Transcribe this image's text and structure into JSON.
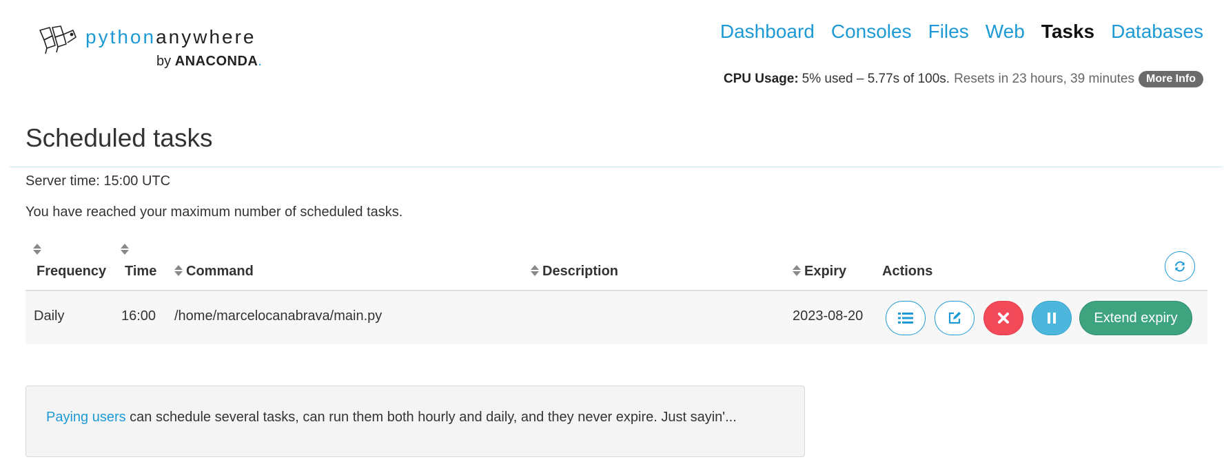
{
  "brand": {
    "python": "python",
    "anywhere": "anywhere",
    "by": "by",
    "company": "ANACONDA",
    "company_dot": "."
  },
  "nav": {
    "items": [
      {
        "label": "Dashboard",
        "active": false
      },
      {
        "label": "Consoles",
        "active": false
      },
      {
        "label": "Files",
        "active": false
      },
      {
        "label": "Web",
        "active": false
      },
      {
        "label": "Tasks",
        "active": true
      },
      {
        "label": "Databases",
        "active": false
      }
    ]
  },
  "cpu": {
    "label": "CPU Usage:",
    "usage": "5% used – 5.77s of 100s.",
    "reset": "Resets in 23 hours, 39 minutes",
    "more_info": "More Info"
  },
  "page": {
    "title": "Scheduled tasks",
    "server_time": "Server time: 15:00 UTC",
    "max_note": "You have reached your maximum number of scheduled tasks."
  },
  "table": {
    "headers": {
      "frequency": "Frequency",
      "time": "Time",
      "command": "Command",
      "description": "Description",
      "expiry": "Expiry",
      "actions": "Actions"
    },
    "rows": [
      {
        "frequency": "Daily",
        "time": "16:00",
        "command": "/home/marcelocanabrava/main.py",
        "description": "",
        "expiry": "2023-08-20",
        "extend_label": "Extend expiry"
      }
    ]
  },
  "icons": {
    "refresh": "refresh-icon",
    "log": "list-icon",
    "edit": "edit-icon",
    "delete": "close-icon",
    "pause": "pause-icon"
  },
  "colors": {
    "accent": "#1d9ad6",
    "danger": "#f34a5a",
    "info": "#4cb6dc",
    "success": "#3ea37f"
  },
  "promo": {
    "link": "Paying users",
    "text": " can schedule several tasks, can run them both hourly and daily, and they never expire. Just sayin'..."
  }
}
